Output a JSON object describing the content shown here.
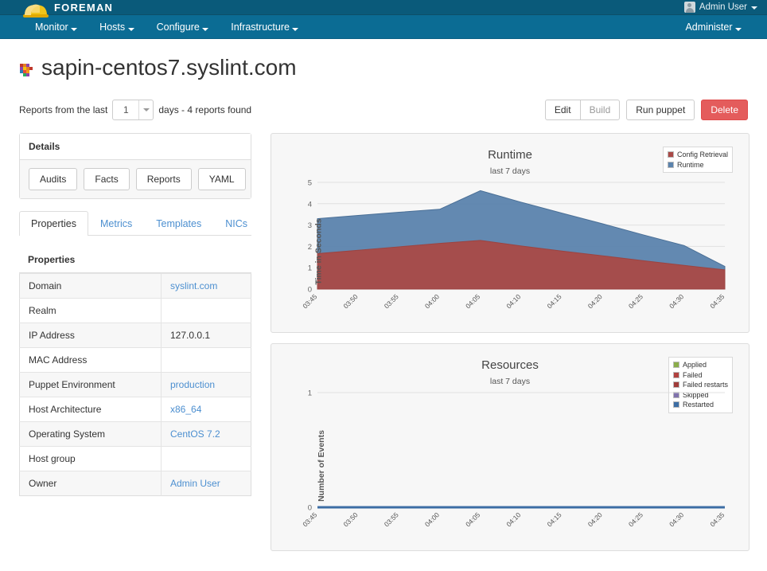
{
  "topbar": {
    "brand": "FOREMAN",
    "logo_icon": "hardhat-icon",
    "user": "Admin User",
    "user_icon": "avatar-icon"
  },
  "nav": {
    "items": [
      {
        "label": "Monitor"
      },
      {
        "label": "Hosts"
      },
      {
        "label": "Configure"
      },
      {
        "label": "Infrastructure"
      }
    ],
    "right": {
      "label": "Administer"
    }
  },
  "header": {
    "title": "sapin-centos7.syslint.com",
    "title_icon": "host-status-icon"
  },
  "reports": {
    "prefix": "Reports from the last",
    "days_value": "1",
    "suffix": "days - 4 reports found",
    "options": [
      "1"
    ]
  },
  "actions": {
    "edit": "Edit",
    "build": "Build",
    "run_puppet": "Run puppet",
    "delete": "Delete",
    "delete_color": "#e45c5c"
  },
  "details": {
    "heading": "Details",
    "buttons": [
      "Audits",
      "Facts",
      "Reports",
      "YAML"
    ]
  },
  "tabs": [
    {
      "label": "Properties",
      "active": true
    },
    {
      "label": "Metrics",
      "active": false
    },
    {
      "label": "Templates",
      "active": false
    },
    {
      "label": "NICs",
      "active": false
    }
  ],
  "properties": {
    "heading": "Properties",
    "rows": [
      {
        "key": "Domain",
        "value": "syslint.com",
        "link": true
      },
      {
        "key": "Realm",
        "value": "",
        "link": false
      },
      {
        "key": "IP Address",
        "value": "127.0.0.1",
        "link": false
      },
      {
        "key": "MAC Address",
        "value": "",
        "link": false
      },
      {
        "key": "Puppet Environment",
        "value": "production",
        "link": true
      },
      {
        "key": "Host Architecture",
        "value": "x86_64",
        "link": true
      },
      {
        "key": "Operating System",
        "value": "CentOS 7.2",
        "link": true
      },
      {
        "key": "Host group",
        "value": "",
        "link": false
      },
      {
        "key": "Owner",
        "value": "Admin User",
        "link": true
      }
    ]
  },
  "chart_data": [
    {
      "type": "area",
      "id": "runtime",
      "title": "Runtime",
      "subtitle": "last 7 days",
      "xlabel": "",
      "ylabel": "Time in Seconds",
      "ylim": [
        0,
        5
      ],
      "yticks": [
        0,
        1,
        2,
        3,
        4,
        5
      ],
      "grid": true,
      "legend_position": "top-right",
      "stacked": true,
      "x": [
        "03:45",
        "03:50",
        "03:55",
        "04:00",
        "04:05",
        "04:10",
        "04:15",
        "04:20",
        "04:25",
        "04:30",
        "04:35"
      ],
      "series": [
        {
          "name": "Config Retrieval",
          "color": "#a94a47",
          "values": [
            1.66,
            1.82,
            1.98,
            2.14,
            2.28,
            2.02,
            1.78,
            1.56,
            1.33,
            1.11,
            0.9
          ]
        },
        {
          "name": "Runtime",
          "color": "#5b83ad",
          "values": [
            1.64,
            1.63,
            1.62,
            1.6,
            2.33,
            2.05,
            1.78,
            1.5,
            1.21,
            0.93,
            0.16
          ]
        }
      ]
    },
    {
      "type": "line",
      "id": "resources",
      "title": "Resources",
      "subtitle": "last 7 days",
      "xlabel": "",
      "ylabel": "Number of Events",
      "ylim": [
        0,
        1
      ],
      "yticks": [
        0,
        1
      ],
      "grid": true,
      "legend_position": "top-right",
      "x": [
        "03:45",
        "03:50",
        "03:55",
        "04:00",
        "04:05",
        "04:10",
        "04:15",
        "04:20",
        "04:25",
        "04:30",
        "04:35"
      ],
      "series": [
        {
          "name": "Applied",
          "color": "#8bad4a",
          "values": [
            0,
            0,
            0,
            0,
            0,
            0,
            0,
            0,
            0,
            0,
            0
          ]
        },
        {
          "name": "Failed",
          "color": "#b1423f",
          "values": [
            0,
            0,
            0,
            0,
            0,
            0,
            0,
            0,
            0,
            0,
            0
          ]
        },
        {
          "name": "Failed restarts",
          "color": "#a03c3a",
          "values": [
            0,
            0,
            0,
            0,
            0,
            0,
            0,
            0,
            0,
            0,
            0
          ]
        },
        {
          "name": "Skipped",
          "color": "#8073ad",
          "values": [
            0,
            0,
            0,
            0,
            0,
            0,
            0,
            0,
            0,
            0,
            0
          ]
        },
        {
          "name": "Restarted",
          "color": "#3d6ea4",
          "values": [
            0,
            0,
            0,
            0,
            0,
            0,
            0,
            0,
            0,
            0,
            0
          ]
        }
      ]
    }
  ]
}
